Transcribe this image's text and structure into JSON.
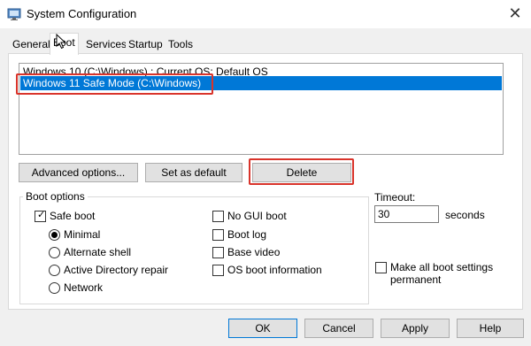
{
  "window": {
    "title": "System Configuration",
    "close_glyph": "✕",
    "icon": "system-config-icon"
  },
  "tabs": [
    {
      "label": "General",
      "active": false
    },
    {
      "label": "Boot",
      "active": true
    },
    {
      "label": "Services",
      "active": false
    },
    {
      "label": "Startup",
      "active": false
    },
    {
      "label": "Tools",
      "active": false
    }
  ],
  "os_list": [
    {
      "text": "Windows 10 (C:\\Windows) : Current OS; Default OS",
      "selected": false
    },
    {
      "text": "Windows 11 Safe Mode (C:\\Windows)",
      "selected": true
    }
  ],
  "buttons": {
    "advanced": "Advanced options...",
    "set_default": "Set as default",
    "delete": "Delete",
    "ok": "OK",
    "cancel": "Cancel",
    "apply": "Apply",
    "help": "Help"
  },
  "boot_options": {
    "group_label": "Boot options",
    "safe_boot": {
      "label": "Safe boot",
      "checked": true
    },
    "radios": [
      {
        "label": "Minimal",
        "selected": true
      },
      {
        "label": "Alternate shell",
        "selected": false
      },
      {
        "label": "Active Directory repair",
        "selected": false
      },
      {
        "label": "Network",
        "selected": false
      }
    ],
    "checks": [
      {
        "label": "No GUI boot",
        "checked": false
      },
      {
        "label": "Boot log",
        "checked": false
      },
      {
        "label": "Base video",
        "checked": false
      },
      {
        "label": "OS boot information",
        "checked": false
      }
    ]
  },
  "timeout": {
    "label": "Timeout:",
    "value": "30",
    "unit": "seconds"
  },
  "make_permanent": {
    "label_line1": "Make all boot settings",
    "label_line2": "permanent",
    "checked": false
  },
  "colors": {
    "accent": "#0078d7",
    "highlight": "#d9342b"
  }
}
